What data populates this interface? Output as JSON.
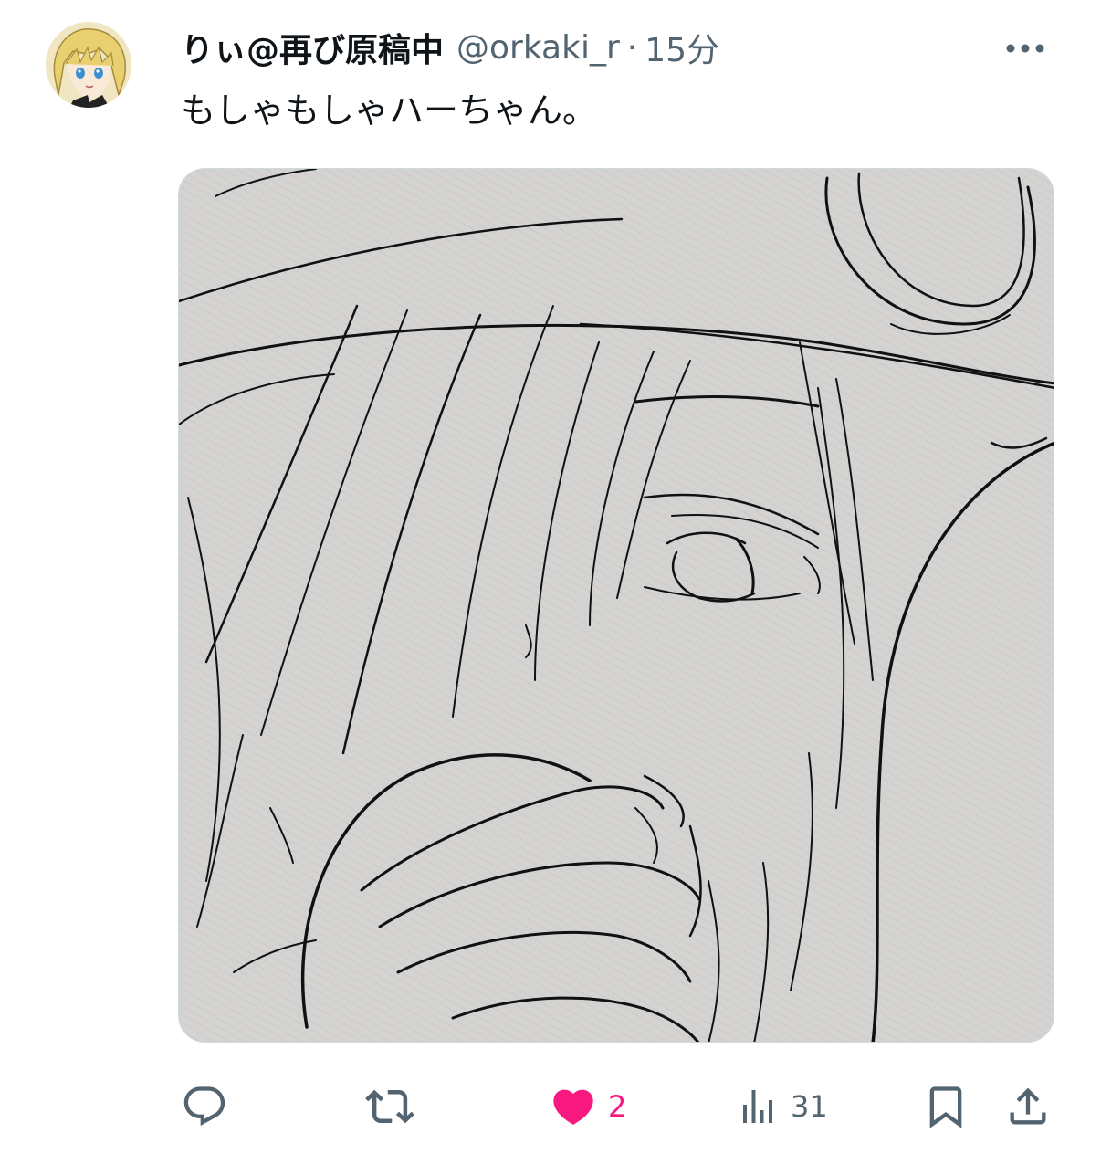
{
  "tweet": {
    "display_name": "りぃ@再び原稿中",
    "handle": "@orkaki_r",
    "separator": "·",
    "time": "15分",
    "text": "もしゃもしゃハーちゃん。",
    "media": {
      "description_icon": "sketch-image"
    }
  },
  "actions": {
    "reply": {
      "icon": "reply-icon"
    },
    "retweet": {
      "icon": "retweet-icon"
    },
    "like": {
      "icon": "heart-icon",
      "count": "2",
      "color": "#f91880"
    },
    "views": {
      "icon": "views-icon",
      "count": "31"
    },
    "bookmark": {
      "icon": "bookmark-icon"
    },
    "share": {
      "icon": "share-icon"
    }
  },
  "colors": {
    "text": "#0f1419",
    "secondary": "#536471",
    "like": "#f91880",
    "border": "#cfd9de"
  }
}
